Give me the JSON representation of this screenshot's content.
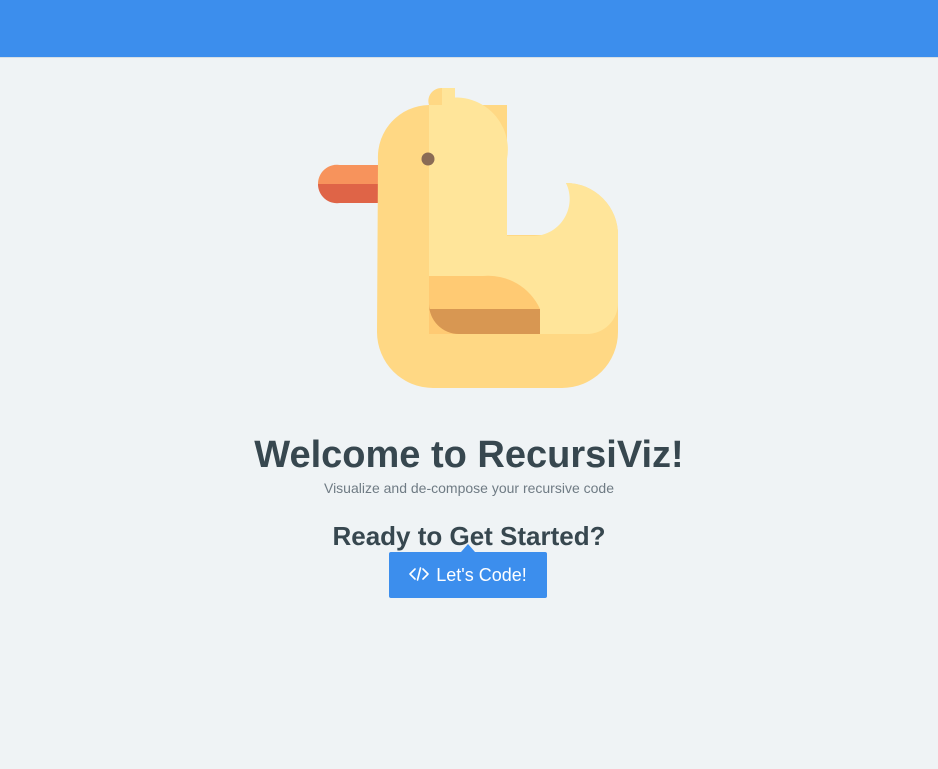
{
  "colors": {
    "accent": "#3c8eed",
    "background": "#eff3f5",
    "text_primary": "#37474f",
    "text_secondary": "#6f7b84"
  },
  "hero": {
    "logo_icon": "rubber-duck-icon",
    "title": "Welcome to RecursiViz!",
    "subtitle": "Visualize and de-compose your recursive code",
    "cta_heading": "Ready to Get Started?"
  },
  "cta": {
    "icon": "code-icon",
    "label": "Let's Code!"
  }
}
